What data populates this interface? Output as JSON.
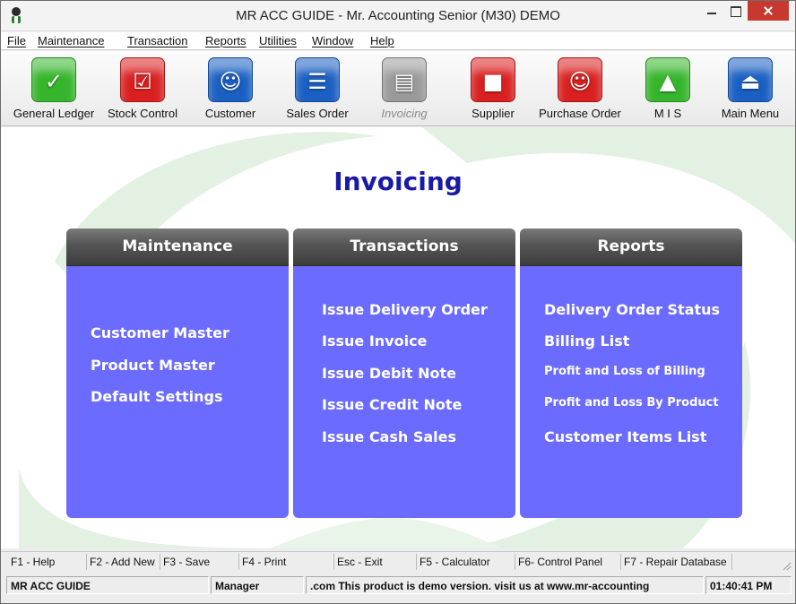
{
  "window": {
    "title": "MR ACC GUIDE - Mr. Accounting Senior (M30) DEMO"
  },
  "menu": [
    "File",
    "Maintenance",
    "Transaction",
    "Reports",
    "Utilities",
    "Window",
    "Help"
  ],
  "toolbar": [
    {
      "label": "General Ledger",
      "icon": "ledger-calculator-icon",
      "color": "#35b52b",
      "enabled": true
    },
    {
      "label": "Stock Control",
      "icon": "clipboard-checklist-icon",
      "color": "#d92020",
      "enabled": true
    },
    {
      "label": "Customer",
      "icon": "customer-person-icon",
      "color": "#1a5fc2",
      "enabled": true
    },
    {
      "label": "Sales Order",
      "icon": "sales-order-icon",
      "color": "#1a5fc2",
      "enabled": true
    },
    {
      "label": "Invoicing",
      "icon": "invoice-document-icon",
      "color": "#9a9a9a",
      "enabled": false
    },
    {
      "label": "Supplier",
      "icon": "supplier-delivery-icon",
      "color": "#d92020",
      "enabled": true
    },
    {
      "label": "Purchase Order",
      "icon": "purchase-order-icon",
      "color": "#d92020",
      "enabled": true
    },
    {
      "label": "M I S",
      "icon": "mis-chart-icon",
      "color": "#35b52b",
      "enabled": true
    },
    {
      "label": "Main Menu",
      "icon": "exit-door-icon",
      "color": "#1a5fc2",
      "enabled": true
    }
  ],
  "page_title": "Invoicing",
  "panels": {
    "maintenance": {
      "heading": "Maintenance",
      "items": [
        "Customer Master",
        "Product Master",
        "Default Settings"
      ]
    },
    "transactions": {
      "heading": "Transactions",
      "items": [
        "Issue Delivery Order",
        "Issue Invoice",
        "Issue Debit Note",
        "Issue Credit Note",
        "Issue Cash Sales"
      ]
    },
    "reports": {
      "heading": "Reports",
      "items": [
        "Delivery Order Status",
        "Billing List",
        "Profit and Loss of Billing",
        "Profit and Loss By Product",
        "Customer Items List"
      ]
    }
  },
  "function_keys": [
    "F1 - Help",
    "F2 - Add New",
    "F3 - Save",
    "F4 - Print",
    "Esc - Exit",
    "F5 - Calculator",
    "F6- Control Panel",
    "F7 - Repair Database"
  ],
  "status": {
    "company": "MR ACC GUIDE",
    "user": "Manager",
    "message": ".com This product is demo version.  visit us at www.mr-accounting",
    "time": "01:40:41 PM"
  },
  "colors": {
    "panel_bg": "#6b6bff",
    "title_color": "#1a1aa6",
    "watermark": "#e3f1e3"
  }
}
